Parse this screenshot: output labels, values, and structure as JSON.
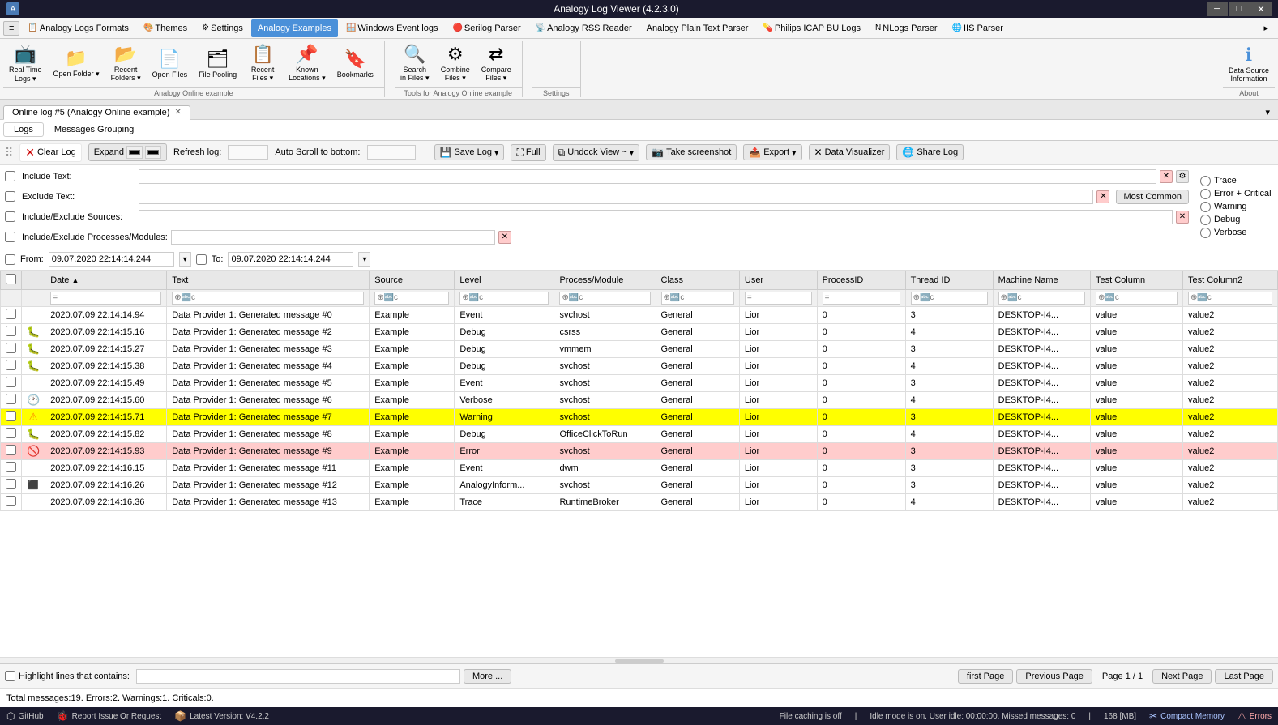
{
  "titlebar": {
    "title": "Analogy Log Viewer (4.2.3.0)",
    "min_btn": "─",
    "max_btn": "□",
    "close_btn": "✕"
  },
  "menubar": {
    "items": [
      {
        "label": "Analogy Logs Formats",
        "active": false
      },
      {
        "label": "Themes",
        "active": false
      },
      {
        "label": "Settings",
        "active": false
      },
      {
        "label": "Analogy Examples",
        "active": true
      },
      {
        "label": "Windows Event logs",
        "active": false
      },
      {
        "label": "Serilog Parser",
        "active": false
      },
      {
        "label": "Analogy RSS Reader",
        "active": false
      },
      {
        "label": "Analogy Plain Text Parser",
        "active": false
      },
      {
        "label": "Philips ICAP BU Logs",
        "active": false
      },
      {
        "label": "NLogs Parser",
        "active": false
      },
      {
        "label": "IIS Parser",
        "active": false
      }
    ]
  },
  "toolbar": {
    "groups": [
      {
        "label": "Analogy Online example",
        "buttons": [
          {
            "label": "Real Time\nLogs",
            "icon": "📺",
            "has_arrow": true
          },
          {
            "label": "Open Folder",
            "icon": "📁",
            "has_arrow": true
          },
          {
            "label": "Recent\nFolders",
            "icon": "📂",
            "has_arrow": true
          },
          {
            "label": "Open Files",
            "icon": "📄",
            "has_arrow": false
          },
          {
            "label": "File Pooling",
            "icon": "🗂",
            "has_arrow": false
          },
          {
            "label": "Recent\nFiles",
            "icon": "📋",
            "has_arrow": true
          },
          {
            "label": "Known\nLocations",
            "icon": "📌",
            "has_arrow": true
          },
          {
            "label": "Bookmarks",
            "icon": "🔖",
            "has_arrow": false
          }
        ]
      },
      {
        "label": "Tools for Analogy Online example",
        "buttons": [
          {
            "label": "Search\nin Files",
            "icon": "🔍",
            "has_arrow": true
          },
          {
            "label": "Combine\nFiles",
            "icon": "⚙",
            "has_arrow": true
          },
          {
            "label": "Compare\nFiles",
            "icon": "⇄",
            "has_arrow": true
          }
        ]
      },
      {
        "label": "Settings",
        "buttons": []
      },
      {
        "label": "About",
        "buttons": [
          {
            "label": "Data Source\nInformation",
            "icon": "ℹ",
            "has_arrow": false
          }
        ]
      }
    ]
  },
  "tab": {
    "label": "Online log #5 (Analogy Online example)",
    "has_close": true
  },
  "logtabs": [
    {
      "label": "Logs",
      "active": true
    },
    {
      "label": "Messages Grouping",
      "active": false
    }
  ],
  "logcontrols": {
    "clear_log": "Clear Log",
    "expand": "Expand",
    "refresh_log": "Refresh log:",
    "auto_scroll": "Auto Scroll to bottom:",
    "save_log": "Save Log",
    "full": "Full",
    "undock_view": "Undock View ~",
    "take_screenshot": "Take screenshot",
    "export": "Export",
    "data_visualizer": "Data Visualizer",
    "share_log": "Share Log"
  },
  "filters": {
    "include_text_label": "Include Text:",
    "exclude_text_label": "Exclude Text:",
    "include_sources_label": "Include/Exclude Sources:",
    "include_processes_label": "Include/Exclude Processes/Modules:",
    "most_common": "Most Common",
    "radio_options": [
      {
        "label": "Trace",
        "checked": false
      },
      {
        "label": "Error + Critical",
        "checked": false
      },
      {
        "label": "Warning",
        "checked": false
      },
      {
        "label": "Debug",
        "checked": false
      },
      {
        "label": "Verbose",
        "checked": false
      }
    ]
  },
  "datefilter": {
    "from_label": "From:",
    "from_value": "09.07.2020 22:14:14.244",
    "to_label": "To:",
    "to_value": "09.07.2020 22:14:14.244"
  },
  "table": {
    "columns": [
      "",
      "",
      "Date",
      "Text",
      "Source",
      "Level",
      "Process/Module",
      "Class",
      "User",
      "ProcessID",
      "Thread ID",
      "Machine Name",
      "Test Column",
      "Test Column2"
    ],
    "column_filter_placeholders": [
      "",
      "",
      "=",
      "⊕🔤c",
      "⊕🔤c",
      "⊕🔤c",
      "⊕🔤c",
      "⊕🔤c",
      "=",
      "=",
      "⊕🔤c",
      "⊕🔤c",
      "⊕🔤c"
    ],
    "rows": [
      {
        "icon": "",
        "icon_type": "none",
        "date": "2020.07.09 22:14:14.94",
        "text": "Data Provider 1: Generated message #0",
        "source": "Example",
        "level": "Event",
        "process": "svchost",
        "class": "General",
        "user": "Lior",
        "pid": "0",
        "tid": "3",
        "machine": "DESKTOP-I4...",
        "col1": "value",
        "col2": "value2",
        "row_class": ""
      },
      {
        "icon": "bug",
        "icon_type": "debug",
        "date": "2020.07.09 22:14:15.16",
        "text": "Data Provider 1: Generated message #2",
        "source": "Example",
        "level": "Debug",
        "process": "csrss",
        "class": "General",
        "user": "Lior",
        "pid": "0",
        "tid": "4",
        "machine": "DESKTOP-I4...",
        "col1": "value",
        "col2": "value2",
        "row_class": ""
      },
      {
        "icon": "bug",
        "icon_type": "debug",
        "date": "2020.07.09 22:14:15.27",
        "text": "Data Provider 1: Generated message #3",
        "source": "Example",
        "level": "Debug",
        "process": "vmmem",
        "class": "General",
        "user": "Lior",
        "pid": "0",
        "tid": "3",
        "machine": "DESKTOP-I4...",
        "col1": "value",
        "col2": "value2",
        "row_class": ""
      },
      {
        "icon": "bug",
        "icon_type": "debug",
        "date": "2020.07.09 22:14:15.38",
        "text": "Data Provider 1: Generated message #4",
        "source": "Example",
        "level": "Debug",
        "process": "svchost",
        "class": "General",
        "user": "Lior",
        "pid": "0",
        "tid": "4",
        "machine": "DESKTOP-I4...",
        "col1": "value",
        "col2": "value2",
        "row_class": ""
      },
      {
        "icon": "",
        "icon_type": "none",
        "date": "2020.07.09 22:14:15.49",
        "text": "Data Provider 1: Generated message #5",
        "source": "Example",
        "level": "Event",
        "process": "svchost",
        "class": "General",
        "user": "Lior",
        "pid": "0",
        "tid": "3",
        "machine": "DESKTOP-I4...",
        "col1": "value",
        "col2": "value2",
        "row_class": ""
      },
      {
        "icon": "clock",
        "icon_type": "verbose",
        "date": "2020.07.09 22:14:15.60",
        "text": "Data Provider 1: Generated message #6",
        "source": "Example",
        "level": "Verbose",
        "process": "svchost",
        "class": "General",
        "user": "Lior",
        "pid": "0",
        "tid": "4",
        "machine": "DESKTOP-I4...",
        "col1": "value",
        "col2": "value2",
        "row_class": ""
      },
      {
        "icon": "warn",
        "icon_type": "warning",
        "date": "2020.07.09 22:14:15.71",
        "text": "Data Provider 1: Generated message #7",
        "source": "Example",
        "level": "Warning",
        "process": "svchost",
        "class": "General",
        "user": "Lior",
        "pid": "0",
        "tid": "3",
        "machine": "DESKTOP-I4...",
        "col1": "value",
        "col2": "value2",
        "row_class": "row-warning"
      },
      {
        "icon": "bug",
        "icon_type": "debug",
        "date": "2020.07.09 22:14:15.82",
        "text": "Data Provider 1: Generated message #8",
        "source": "Example",
        "level": "Debug",
        "process": "OfficeClickToRun",
        "class": "General",
        "user": "Lior",
        "pid": "0",
        "tid": "4",
        "machine": "DESKTOP-I4...",
        "col1": "value",
        "col2": "value2",
        "row_class": ""
      },
      {
        "icon": "err",
        "icon_type": "error",
        "date": "2020.07.09 22:14:15.93",
        "text": "Data Provider 1: Generated message #9",
        "source": "Example",
        "level": "Error",
        "process": "svchost",
        "class": "General",
        "user": "Lior",
        "pid": "0",
        "tid": "3",
        "machine": "DESKTOP-I4...",
        "col1": "value",
        "col2": "value2",
        "row_class": "row-error"
      },
      {
        "icon": "",
        "icon_type": "none",
        "date": "2020.07.09 22:14:16.15",
        "text": "Data Provider 1: Generated message #11",
        "source": "Example",
        "level": "Event",
        "process": "dwm",
        "class": "General",
        "user": "Lior",
        "pid": "0",
        "tid": "3",
        "machine": "DESKTOP-I4...",
        "col1": "value",
        "col2": "value2",
        "row_class": ""
      },
      {
        "icon": "blk",
        "icon_type": "black",
        "date": "2020.07.09 22:14:16.26",
        "text": "Data Provider 1: Generated message #12",
        "source": "Example",
        "level": "AnalogyInform...",
        "process": "svchost",
        "class": "General",
        "user": "Lior",
        "pid": "0",
        "tid": "3",
        "machine": "DESKTOP-I4...",
        "col1": "value",
        "col2": "value2",
        "row_class": ""
      },
      {
        "icon": "",
        "icon_type": "none",
        "date": "2020.07.09 22:14:16.36",
        "text": "Data Provider 1: Generated message #13",
        "source": "Example",
        "level": "Trace",
        "process": "RuntimeBroker",
        "class": "General",
        "user": "Lior",
        "pid": "0",
        "tid": "4",
        "machine": "DESKTOP-I4...",
        "col1": "value",
        "col2": "value2",
        "row_class": ""
      }
    ]
  },
  "pagination": {
    "highlight_label": "Highlight lines that contains:",
    "more_btn": "More ...",
    "first_page": "first Page",
    "previous_page": "Previous Page",
    "page_info": "Page 1 / 1",
    "next_page": "Next Page",
    "last_page": "Last Page"
  },
  "totalbar": {
    "text": "Total messages:19. Errors:2. Warnings:1. Criticals:0."
  },
  "statusbar": {
    "github": "GitHub",
    "report_issue": "Report Issue Or Request",
    "latest_version": "Latest Version: V4.2.2",
    "file_caching": "File caching is off",
    "idle_mode": "Idle mode is on. User idle: 00:00:00. Missed messages: 0",
    "memory": "168 [MB]",
    "compact_memory": "Compact Memory",
    "errors": "Errors"
  }
}
